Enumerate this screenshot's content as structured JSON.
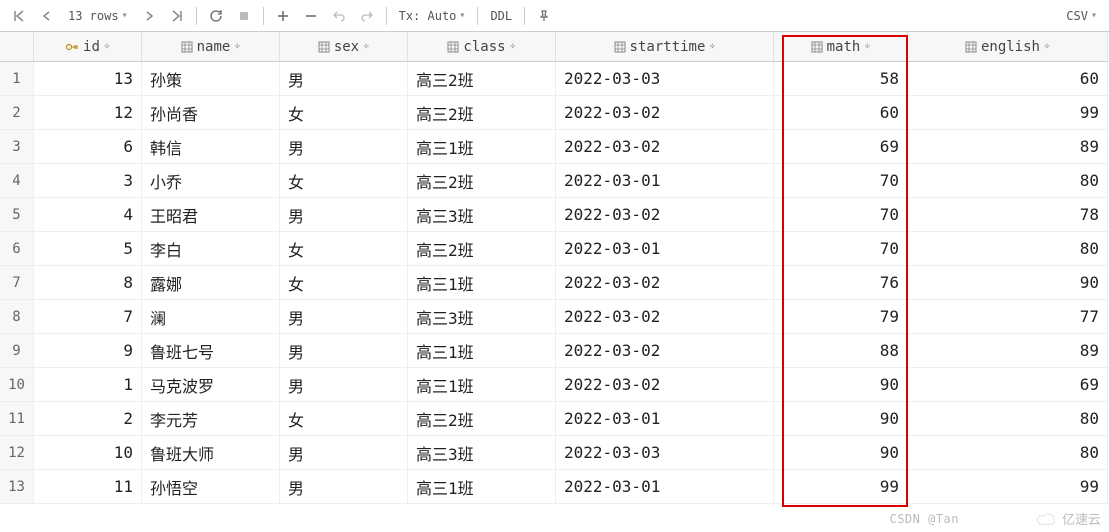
{
  "toolbar": {
    "row_count_label": "13 rows",
    "tx_label": "Tx: Auto",
    "ddl_label": "DDL",
    "csv_label": "CSV"
  },
  "columns": [
    {
      "name": "id",
      "align": "num",
      "type": "key"
    },
    {
      "name": "name",
      "align": "txt",
      "type": "col"
    },
    {
      "name": "sex",
      "align": "txt",
      "type": "col"
    },
    {
      "name": "class",
      "align": "txt",
      "type": "col"
    },
    {
      "name": "starttime",
      "align": "txt",
      "type": "col"
    },
    {
      "name": "math",
      "align": "num",
      "type": "col"
    },
    {
      "name": "english",
      "align": "num",
      "type": "col"
    }
  ],
  "rows": [
    {
      "n": "1",
      "id": "13",
      "name": "孙策",
      "sex": "男",
      "class": "高三2班",
      "starttime": "2022-03-03",
      "math": "58",
      "english": "60"
    },
    {
      "n": "2",
      "id": "12",
      "name": "孙尚香",
      "sex": "女",
      "class": "高三2班",
      "starttime": "2022-03-02",
      "math": "60",
      "english": "99"
    },
    {
      "n": "3",
      "id": "6",
      "name": "韩信",
      "sex": "男",
      "class": "高三1班",
      "starttime": "2022-03-02",
      "math": "69",
      "english": "89"
    },
    {
      "n": "4",
      "id": "3",
      "name": "小乔",
      "sex": "女",
      "class": "高三2班",
      "starttime": "2022-03-01",
      "math": "70",
      "english": "80"
    },
    {
      "n": "5",
      "id": "4",
      "name": "王昭君",
      "sex": "男",
      "class": "高三3班",
      "starttime": "2022-03-02",
      "math": "70",
      "english": "78"
    },
    {
      "n": "6",
      "id": "5",
      "name": "李白",
      "sex": "女",
      "class": "高三2班",
      "starttime": "2022-03-01",
      "math": "70",
      "english": "80"
    },
    {
      "n": "7",
      "id": "8",
      "name": "露娜",
      "sex": "女",
      "class": "高三1班",
      "starttime": "2022-03-02",
      "math": "76",
      "english": "90"
    },
    {
      "n": "8",
      "id": "7",
      "name": "澜",
      "sex": "男",
      "class": "高三3班",
      "starttime": "2022-03-02",
      "math": "79",
      "english": "77"
    },
    {
      "n": "9",
      "id": "9",
      "name": "鲁班七号",
      "sex": "男",
      "class": "高三1班",
      "starttime": "2022-03-02",
      "math": "88",
      "english": "89"
    },
    {
      "n": "10",
      "id": "1",
      "name": "马克波罗",
      "sex": "男",
      "class": "高三1班",
      "starttime": "2022-03-02",
      "math": "90",
      "english": "69"
    },
    {
      "n": "11",
      "id": "2",
      "name": "李元芳",
      "sex": "女",
      "class": "高三2班",
      "starttime": "2022-03-01",
      "math": "90",
      "english": "80"
    },
    {
      "n": "12",
      "id": "10",
      "name": "鲁班大师",
      "sex": "男",
      "class": "高三3班",
      "starttime": "2022-03-03",
      "math": "90",
      "english": "80"
    },
    {
      "n": "13",
      "id": "11",
      "name": "孙悟空",
      "sex": "男",
      "class": "高三1班",
      "starttime": "2022-03-01",
      "math": "99",
      "english": "99"
    }
  ],
  "watermarks": {
    "w1": "CSDN @Tan",
    "w2": "亿速云"
  }
}
